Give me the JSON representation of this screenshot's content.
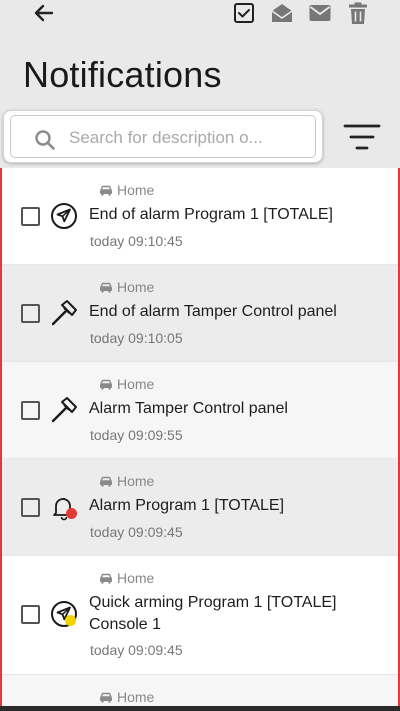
{
  "header": {
    "title": "Notifications",
    "back_icon": "arrow-left-icon",
    "actions": [
      "select-all-icon",
      "mark-read-icon",
      "mark-unread-icon",
      "delete-icon"
    ]
  },
  "search": {
    "placeholder": "Search for description o...",
    "value": ""
  },
  "filter_icon": "filter-icon",
  "colors": {
    "accent_border": "#e53935",
    "alarm_dot": "#e53935",
    "arming_dot": "#f2d500"
  },
  "notifications": [
    {
      "source": "Home",
      "message": "End of alarm Program 1 [TOTALE]",
      "time": "today 09:10:45",
      "icon": "plane-icon",
      "status": ""
    },
    {
      "source": "Home",
      "message": "End of alarm Tamper Control panel",
      "time": "today 09:10:05",
      "icon": "hammer-icon",
      "status": ""
    },
    {
      "source": "Home",
      "message": "Alarm Tamper Control panel",
      "time": "today 09:09:55",
      "icon": "hammer-icon",
      "status": ""
    },
    {
      "source": "Home",
      "message": "Alarm Program 1 [TOTALE]",
      "time": "today 09:09:45",
      "icon": "bell-icon",
      "status": "red"
    },
    {
      "source": "Home",
      "message": "Quick arming Program 1 [TOTALE] Console 1",
      "time": "today 09:09:45",
      "icon": "plane-icon",
      "status": "yellow"
    },
    {
      "source": "Home",
      "message": "",
      "time": "",
      "icon": "",
      "status": ""
    }
  ]
}
